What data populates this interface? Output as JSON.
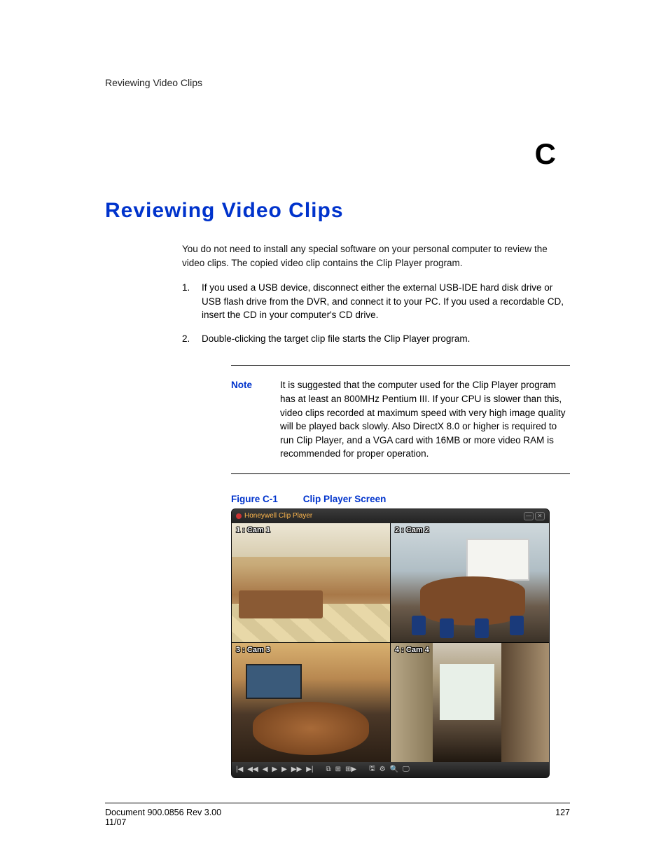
{
  "header": {
    "section_title": "Reviewing Video Clips"
  },
  "appendix": {
    "letter": "C"
  },
  "page_title": "Reviewing Video Clips",
  "intro": "You do not need to install any special software on your personal computer to review the video clips. The copied video clip contains the Clip Player program.",
  "steps": [
    "If you used a USB device, disconnect either the external USB-IDE hard disk drive or USB flash drive from the DVR, and connect it to your PC. If you used a recordable CD, insert the CD in your computer's CD drive.",
    "Double-clicking the target clip file starts the Clip Player program."
  ],
  "note": {
    "label": "Note",
    "text": "It is suggested that the computer used for the Clip Player program has at least an 800MHz Pentium III. If your CPU is slower than this, video clips recorded at maximum speed with very high image quality will be played back slowly. Also DirectX 8.0 or higher is required to run Clip Player, and a VGA card with 16MB or more video RAM is recommended for proper operation."
  },
  "figure": {
    "label": "Figure C-1",
    "title": "Clip Player Screen"
  },
  "clip_player": {
    "app_title": "Honeywell Clip Player",
    "cams": {
      "cam1": "1 : Cam 1",
      "cam2": "2 : Cam 2",
      "cam3": "3 : Cam 3",
      "cam4": "4 : Cam 4"
    },
    "controls": [
      "|◀",
      "◀◀",
      "◀",
      "▶",
      "▶",
      "▶▶",
      "▶|",
      "⧉",
      "⊞",
      "⊞▶",
      "🖫",
      "⚙",
      "🔍",
      "🖵"
    ]
  },
  "footer": {
    "doc": "Document 900.0856 Rev 3.00",
    "date": "11/07",
    "page": "127"
  }
}
